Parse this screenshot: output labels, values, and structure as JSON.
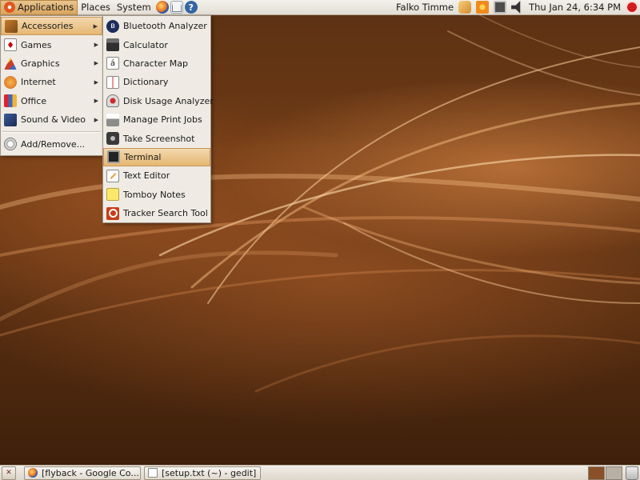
{
  "top_panel": {
    "menus": [
      {
        "label": "Applications",
        "icon": "ubuntu-logo-icon"
      },
      {
        "label": "Places"
      },
      {
        "label": "System"
      }
    ],
    "launchers": [
      "firefox-icon",
      "mail-icon",
      "help-icon"
    ],
    "help_glyph": "?",
    "user_name": "Falko Timme",
    "clock": "Thu Jan 24,  6:34 PM"
  },
  "applications_menu": {
    "items": [
      {
        "label": "Accessories",
        "icon": "accessories-icon",
        "has_submenu": true
      },
      {
        "label": "Games",
        "icon": "games-icon",
        "has_submenu": true
      },
      {
        "label": "Graphics",
        "icon": "graphics-icon",
        "has_submenu": true
      },
      {
        "label": "Internet",
        "icon": "internet-icon",
        "has_submenu": true
      },
      {
        "label": "Office",
        "icon": "office-icon",
        "has_submenu": true
      },
      {
        "label": "Sound & Video",
        "icon": "sound-video-icon",
        "has_submenu": true
      },
      {
        "label": "Add/Remove...",
        "icon": "add-remove-icon",
        "has_submenu": false
      }
    ],
    "submenu_arrow": "▶"
  },
  "accessories_menu": {
    "items": [
      {
        "label": "Bluetooth Analyzer",
        "icon": "bluetooth-icon"
      },
      {
        "label": "Calculator",
        "icon": "calculator-icon"
      },
      {
        "label": "Character Map",
        "icon": "character-map-icon",
        "glyph": "á"
      },
      {
        "label": "Dictionary",
        "icon": "dictionary-icon"
      },
      {
        "label": "Disk Usage Analyzer",
        "icon": "disk-usage-icon"
      },
      {
        "label": "Manage Print Jobs",
        "icon": "print-jobs-icon"
      },
      {
        "label": "Take Screenshot",
        "icon": "screenshot-icon"
      },
      {
        "label": "Terminal",
        "icon": "terminal-icon",
        "highlighted": true
      },
      {
        "label": "Text Editor",
        "icon": "text-editor-icon"
      },
      {
        "label": "Tomboy Notes",
        "icon": "tomboy-icon"
      },
      {
        "label": "Tracker Search Tool",
        "icon": "tracker-search-icon"
      }
    ]
  },
  "bottom_panel": {
    "tasks": [
      {
        "label": "[flyback - Google Co...",
        "icon": "firefox-icon"
      },
      {
        "label": "[setup.txt (~) - gedit]",
        "icon": "gedit-icon"
      }
    ]
  },
  "colors": {
    "highlight": "#e6b773",
    "panel": "#e3ded4",
    "menu_bg": "#efebe4",
    "wallpaper": "#5d3214"
  }
}
